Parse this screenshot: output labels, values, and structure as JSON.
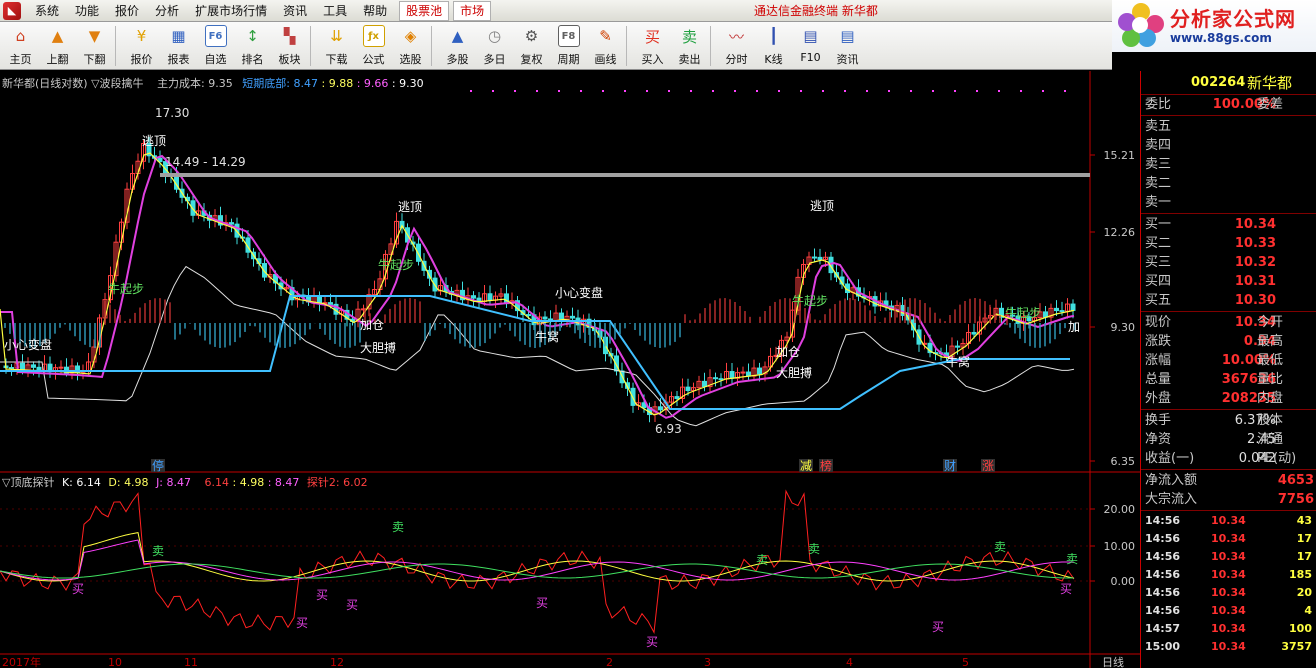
{
  "menubar": {
    "items": [
      "系统",
      "功能",
      "报价",
      "分析",
      "扩展市场行情",
      "资讯",
      "工具",
      "帮助"
    ],
    "tabs": [
      "股票池",
      "市场"
    ],
    "title": "通达信金融终端 新华都"
  },
  "brand": {
    "name": "分析家公式网",
    "url": "www.88gs.com"
  },
  "toolbar": [
    {
      "label": "主页",
      "icon": "home-icon",
      "color": "#d04020",
      "glyph": "⌂"
    },
    {
      "label": "上翻",
      "icon": "arrow-up-icon",
      "color": "#e08010",
      "glyph": "▲"
    },
    {
      "label": "下翻",
      "icon": "arrow-down-icon",
      "color": "#e08010",
      "glyph": "▼"
    },
    {
      "label": "报价",
      "icon": "price-icon",
      "color": "#e0a000",
      "glyph": "¥"
    },
    {
      "label": "报表",
      "icon": "report-icon",
      "color": "#3060c0",
      "glyph": "▦"
    },
    {
      "label": "自选",
      "icon": "f6-icon",
      "color": "#4070c0",
      "glyph": "F6"
    },
    {
      "label": "排名",
      "icon": "rank-icon",
      "color": "#30a040",
      "glyph": "↕"
    },
    {
      "label": "板块",
      "icon": "sector-icon",
      "color": "#c04040",
      "glyph": "▚"
    },
    {
      "label": "下载",
      "icon": "download-icon",
      "color": "#e0a000",
      "glyph": "⇊"
    },
    {
      "label": "公式",
      "icon": "formula-icon",
      "color": "#d0a000",
      "glyph": "ƒx"
    },
    {
      "label": "选股",
      "icon": "select-stock-icon",
      "color": "#e08000",
      "glyph": "◈"
    },
    {
      "label": "多股",
      "icon": "multi-stock-icon",
      "color": "#3060c0",
      "glyph": "▲"
    },
    {
      "label": "多日",
      "icon": "multi-day-icon",
      "color": "#808080",
      "glyph": "◷"
    },
    {
      "label": "复权",
      "icon": "adjust-icon",
      "color": "#505050",
      "glyph": "⚙"
    },
    {
      "label": "周期",
      "icon": "f8-icon",
      "color": "#606060",
      "glyph": "F8"
    },
    {
      "label": "画线",
      "icon": "draw-line-icon",
      "color": "#d04000",
      "glyph": "✎"
    },
    {
      "label": "买入",
      "icon": "buy-icon",
      "color": "#e03020",
      "glyph": "买"
    },
    {
      "label": "卖出",
      "icon": "sell-icon",
      "color": "#20a040",
      "glyph": "卖"
    },
    {
      "label": "分时",
      "icon": "intraday-icon",
      "color": "#c03030",
      "glyph": "〰"
    },
    {
      "label": "K线",
      "icon": "kline-icon",
      "color": "#3050b0",
      "glyph": "┃"
    },
    {
      "label": "F10",
      "icon": "f10-icon",
      "color": "#3050b0",
      "glyph": "▤"
    },
    {
      "label": "资讯",
      "icon": "news-icon",
      "color": "#3060c0",
      "glyph": "▤"
    }
  ],
  "main_header": {
    "name": "新华都(日线对数)",
    "indicator": "▽波段擒牛",
    "cost_label": "主力成本:",
    "cost_val": "9.35",
    "bottom_label": "短期底部:",
    "bottom_vals": [
      "8.47",
      "9.88",
      "9.66",
      "9.30"
    ]
  },
  "sub_header": {
    "name": "▽顶底探针",
    "k": "K: 6.14",
    "d": "D: 4.98",
    "j": "J: 8.47",
    "vals": [
      "6.14",
      "4.98",
      "8.47"
    ],
    "probe": "探针2: 6.02"
  },
  "price_axis": [
    "15.21",
    "12.26",
    "9.30",
    "6.35"
  ],
  "osc_axis": [
    "20.00",
    "10.00",
    "0.00"
  ],
  "dates": [
    "2017年",
    "10",
    "11",
    "12",
    "2",
    "3",
    "4",
    "5"
  ],
  "annotations": {
    "high": "17.30",
    "range": "14.49 - 14.29",
    "low": "6.93",
    "labels": [
      "逃顶",
      "逃顶",
      "逃顶",
      "牛起步",
      "牛起步",
      "牛起步",
      "牛起步",
      "小心变盘",
      "小心变盘",
      "加仓",
      "加仓",
      "大胆搏",
      "大胆搏",
      "牛窝",
      "牛窝",
      "加"
    ],
    "events": [
      "停",
      "减",
      "榜",
      "财",
      "涨"
    ],
    "buy": "买",
    "sell": "卖"
  },
  "period": "日线",
  "quote": {
    "code": "002264",
    "name": "新华都",
    "weibi_label": "委比",
    "weibi": "100.00%",
    "weicha_label": "委差",
    "sells": [
      "卖五",
      "卖四",
      "卖三",
      "卖二",
      "卖一"
    ],
    "buys": [
      {
        "l": "买一",
        "v": "10.34"
      },
      {
        "l": "买二",
        "v": "10.33"
      },
      {
        "l": "买三",
        "v": "10.32"
      },
      {
        "l": "买四",
        "v": "10.31"
      },
      {
        "l": "买五",
        "v": "10.30"
      }
    ],
    "stats": [
      {
        "l": "现价",
        "v": "10.34",
        "r": "今开"
      },
      {
        "l": "涨跌",
        "v": "0.94",
        "r": "最高"
      },
      {
        "l": "涨幅",
        "v": "10.00%",
        "r": "最低"
      },
      {
        "l": "总量",
        "v": "367636",
        "r": "量比"
      },
      {
        "l": "外盘",
        "v": "208235",
        "r": "内盘"
      }
    ],
    "stats2": [
      {
        "l": "换手",
        "v": "6.37%",
        "r": "股本"
      },
      {
        "l": "净资",
        "v": "2.45",
        "r": "流通"
      },
      {
        "l": "收益(一)",
        "v": "0.042",
        "r": "PE(动)"
      }
    ],
    "flows": [
      {
        "l": "净流入额",
        "v": "4653"
      },
      {
        "l": "大宗流入",
        "v": "7756"
      }
    ],
    "ticks": [
      {
        "t": "14:56",
        "p": "10.34",
        "v": "43"
      },
      {
        "t": "14:56",
        "p": "10.34",
        "v": "17"
      },
      {
        "t": "14:56",
        "p": "10.34",
        "v": "17"
      },
      {
        "t": "14:56",
        "p": "10.34",
        "v": "185"
      },
      {
        "t": "14:56",
        "p": "10.34",
        "v": "20"
      },
      {
        "t": "14:56",
        "p": "10.34",
        "v": "4"
      },
      {
        "t": "14:57",
        "p": "10.34",
        "v": "100"
      },
      {
        "t": "15:00",
        "p": "10.34",
        "v": "3757"
      }
    ]
  }
}
